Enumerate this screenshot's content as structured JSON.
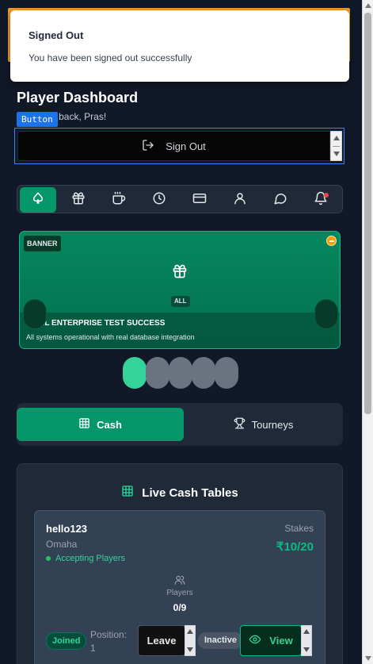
{
  "toast": {
    "title": "Signed Out",
    "message": "You have been signed out successfully"
  },
  "header": {
    "title": "Player Dashboard",
    "welcome": "Welcome back, Pras!",
    "welcome_visible": "back, Pras!",
    "overlay_tag": "Button"
  },
  "signout": {
    "label": "Sign Out"
  },
  "nav": {
    "items": [
      {
        "icon": "spade-icon",
        "active": true
      },
      {
        "icon": "gift-icon"
      },
      {
        "icon": "coffee-icon"
      },
      {
        "icon": "clock-icon"
      },
      {
        "icon": "card-icon"
      },
      {
        "icon": "user-icon"
      },
      {
        "icon": "chat-icon"
      },
      {
        "icon": "bell-icon",
        "has_notification": true
      }
    ]
  },
  "banner": {
    "tag": "BANNER",
    "badge": "ALL",
    "title": "FINAL ENTERPRISE TEST SUCCESS",
    "subtitle": "All systems operational with real database integration",
    "slides": 5,
    "active_slide": 0
  },
  "tabs": {
    "cash": "Cash",
    "tourneys": "Tourneys",
    "active": "cash"
  },
  "live_tables": {
    "title": "Live Cash Tables",
    "table": {
      "name": "hello123",
      "game": "Omaha",
      "status": "Accepting Players",
      "stakes_label": "Stakes",
      "stakes": "₹10/20",
      "players_label": "Players",
      "players": "0/9",
      "joined_label": "Joined",
      "position_label": "Position:",
      "position_value": "1",
      "leave_label": "Leave",
      "inactive_label": "Inactive",
      "view_label": "View"
    }
  },
  "colors": {
    "accent": "#059669",
    "accent_light": "#34d399",
    "background": "#111827",
    "panel": "#1f2937",
    "toast_border": "#e89a2c"
  }
}
